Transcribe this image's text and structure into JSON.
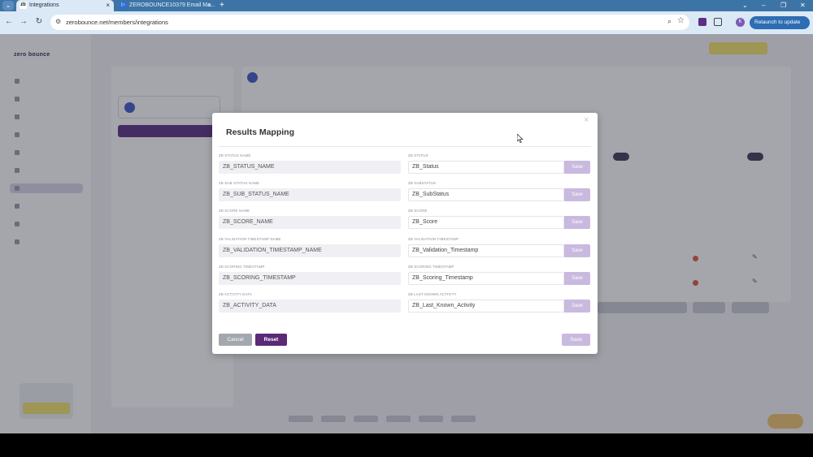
{
  "browser": {
    "tab_menu_icon": "chevron-down-icon",
    "tabs": [
      {
        "label": "Integrations",
        "favicon": "zb",
        "close": "×"
      },
      {
        "label": "ZEROBOUNCE10379 Email Ma...",
        "favicon": "▷",
        "close": "×"
      }
    ],
    "new_tab": "+",
    "window_controls": [
      "⌄",
      "–",
      "❐",
      "✕"
    ],
    "url": "zerobounce.net/members/integrations",
    "relaunch_label": "Relaunch to update",
    "profile_initial": "K"
  },
  "modal": {
    "title": "Results Mapping",
    "close": "×",
    "rows": [
      {
        "left_label": "ZB STATUS NAME",
        "left_value": "ZB_STATUS_NAME",
        "right_label": "ZB STATUS",
        "right_value": "ZB_Status",
        "save": "Save"
      },
      {
        "left_label": "ZB SUB STATUS NAME",
        "left_value": "ZB_SUB_STATUS_NAME",
        "right_label": "ZB SUBSTATUS",
        "right_value": "ZB_SubStatus",
        "save": "Save"
      },
      {
        "left_label": "ZB SCORE NAME",
        "left_value": "ZB_SCORE_NAME",
        "right_label": "ZB SCORE",
        "right_value": "ZB_Score",
        "save": "Save"
      },
      {
        "left_label": "ZB VALIDATION TIMESTAMP NAME",
        "left_value": "ZB_VALIDATION_TIMESTAMP_NAME",
        "right_label": "ZB VALIDATION TIMESTAMP",
        "right_value": "ZB_Validation_Timestamp",
        "save": "Save"
      },
      {
        "left_label": "ZB SCORING TIMESTAMP",
        "left_value": "ZB_SCORING_TIMESTAMP",
        "right_label": "ZB SCORING TIMESTAMP",
        "right_value": "ZB_Scoring_Timestamp",
        "save": "Save"
      },
      {
        "left_label": "ZB ACTIVITY DATA",
        "left_value": "ZB_ACTIVITY_DATA",
        "right_label": "ZB LAST KNOWN ACTIVITY",
        "right_value": "ZB_Last_Known_Activity",
        "save": "Save"
      }
    ],
    "cancel_label": "Cancel",
    "reset_label": "Reset",
    "save_label": "Save"
  },
  "colors": {
    "accent": "#5b2a76",
    "save_disabled": "#c9b9df",
    "cancel": "#a3a7ae",
    "browser_tabstrip": "#3d74a6",
    "relaunch": "#2d6db3"
  }
}
